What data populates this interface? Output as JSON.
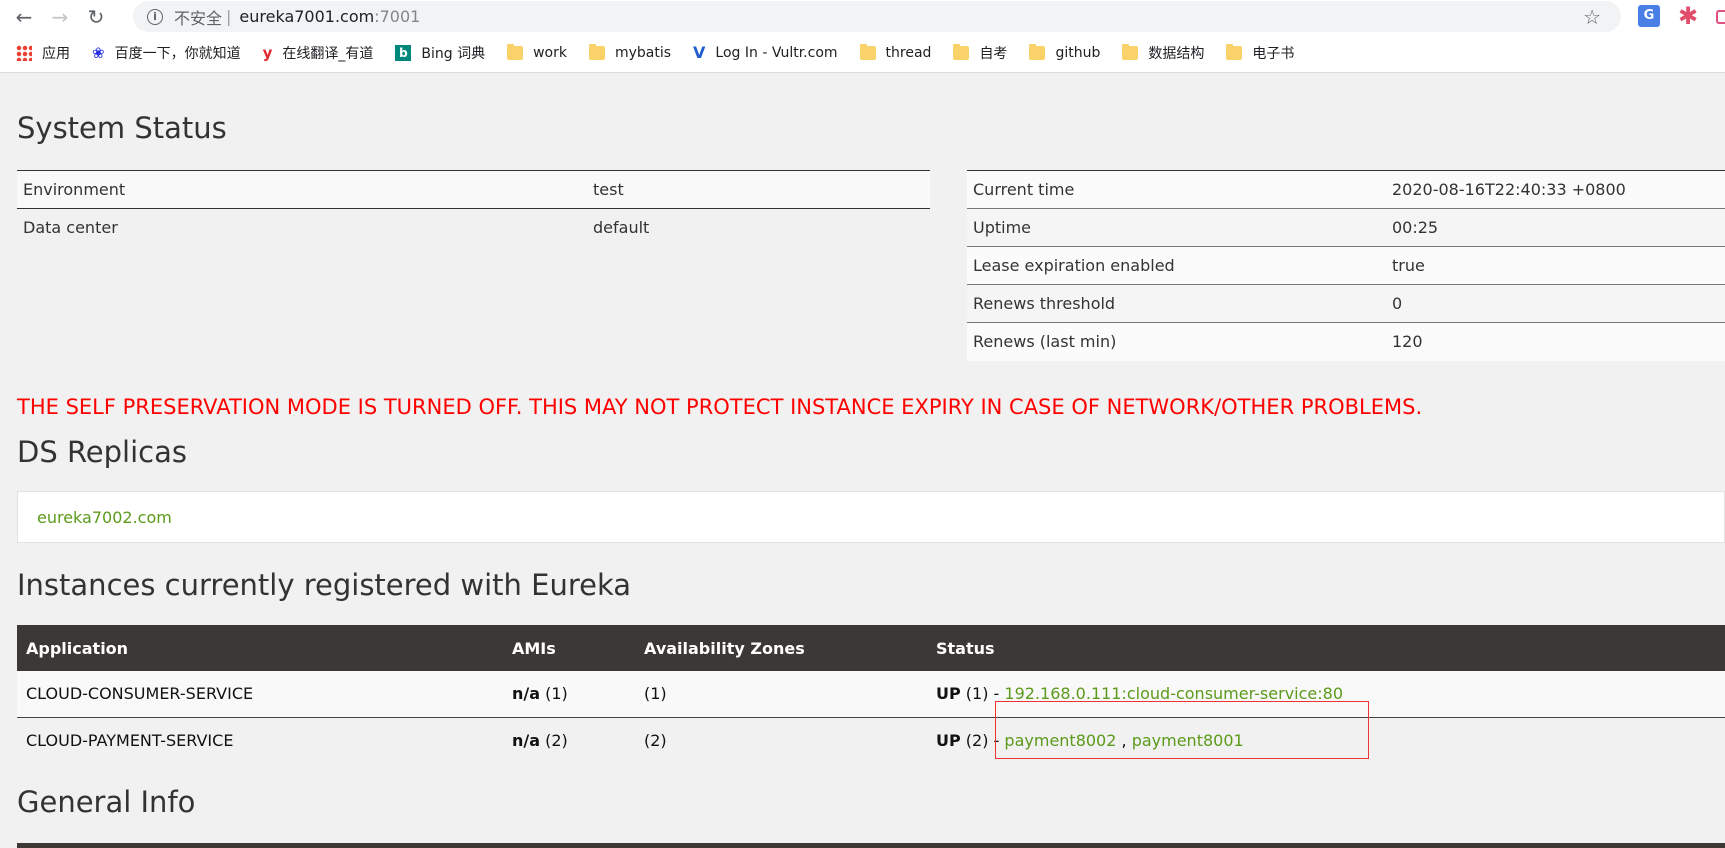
{
  "browser": {
    "url_security_label": "不安全",
    "url_host": "eureka7001.com",
    "url_port": ":7001",
    "extension_icons": [
      "translate-icon",
      "pinwheel-icon",
      "partial-extension-icon"
    ]
  },
  "bookmarks": [
    {
      "label": "应用",
      "icon": "apps-icon"
    },
    {
      "label": "百度一下，你就知道",
      "icon": "baidu-icon"
    },
    {
      "label": "在线翻译_有道",
      "icon": "youdao-icon"
    },
    {
      "label": "Bing 词典",
      "icon": "bing-icon"
    },
    {
      "label": "work",
      "icon": "folder-icon"
    },
    {
      "label": "mybatis",
      "icon": "folder-icon"
    },
    {
      "label": "Log In - Vultr.com",
      "icon": "vultr-icon"
    },
    {
      "label": "thread",
      "icon": "folder-icon"
    },
    {
      "label": "自考",
      "icon": "folder-icon"
    },
    {
      "label": "github",
      "icon": "folder-icon"
    },
    {
      "label": "数据结构",
      "icon": "folder-icon"
    },
    {
      "label": "电子书",
      "icon": "folder-icon"
    }
  ],
  "system_status": {
    "title": "System Status",
    "left": [
      {
        "key": "Environment",
        "value": "test"
      },
      {
        "key": "Data center",
        "value": "default"
      }
    ],
    "right": [
      {
        "key": "Current time",
        "value": "2020-08-16T22:40:33 +0800"
      },
      {
        "key": "Uptime",
        "value": "00:25"
      },
      {
        "key": "Lease expiration enabled",
        "value": "true"
      },
      {
        "key": "Renews threshold",
        "value": "0"
      },
      {
        "key": "Renews (last min)",
        "value": "120"
      }
    ]
  },
  "warning": "THE SELF PRESERVATION MODE IS TURNED OFF. THIS MAY NOT PROTECT INSTANCE EXPIRY IN CASE OF NETWORK/OTHER PROBLEMS.",
  "replicas": {
    "title": "DS Replicas",
    "link": "eureka7002.com"
  },
  "instances": {
    "title": "Instances currently registered with Eureka",
    "headers": [
      "Application",
      "AMIs",
      "Availability Zones",
      "Status"
    ],
    "rows": [
      {
        "application": "CLOUD-CONSUMER-SERVICE",
        "amis_bold": "n/a",
        "amis_count": " (1)",
        "zones": "(1)",
        "status_bold": "UP",
        "status_count": " (1) - ",
        "links": [
          "192.168.0.111:cloud-consumer-service:80"
        ]
      },
      {
        "application": "CLOUD-PAYMENT-SERVICE",
        "amis_bold": "n/a",
        "amis_count": " (2)",
        "zones": "(2)",
        "status_bold": "UP",
        "status_count": " (2) - ",
        "links": [
          "payment8002",
          "payment8001"
        ],
        "link_separator": " , "
      }
    ]
  },
  "general_info": {
    "title": "General Info"
  }
}
